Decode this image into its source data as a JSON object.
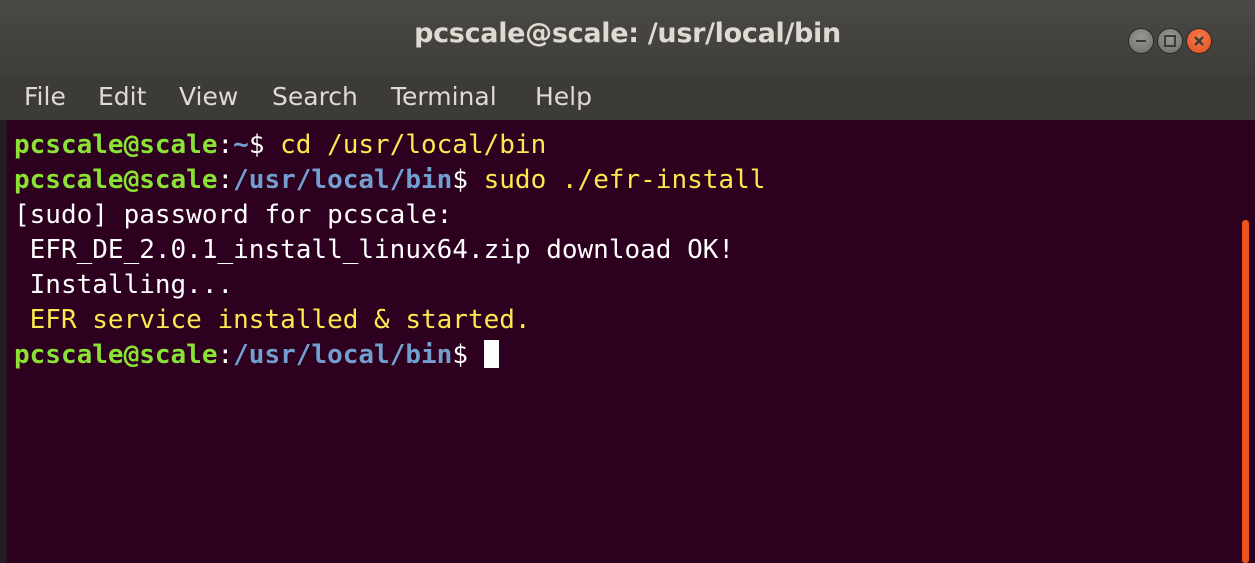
{
  "window": {
    "title": "pcscale@scale: /usr/local/bin",
    "controls": {
      "minimize_icon": "minimize-icon",
      "maximize_icon": "maximize-icon",
      "close_icon": "close-icon"
    }
  },
  "menu": {
    "items": [
      "File",
      "Edit",
      "View",
      "Search",
      "Terminal",
      "Help"
    ]
  },
  "terminal": {
    "lines": [
      {
        "prompt_user": "pcscale@scale",
        "prompt_sep": ":",
        "prompt_path": "~",
        "prompt_dollar": "$ ",
        "command": "cd /usr/local/bin"
      },
      {
        "prompt_user": "pcscale@scale",
        "prompt_sep": ":",
        "prompt_path": "/usr/local/bin",
        "prompt_dollar": "$ ",
        "command": "sudo ./efr-install"
      },
      {
        "output": "[sudo] password for pcscale:"
      },
      {
        "output": " EFR_DE_2.0.1_install_linux64.zip download OK!"
      },
      {
        "output": " Installing..."
      },
      {
        "output": " EFR service installed & started."
      },
      {
        "prompt_user": "pcscale@scale",
        "prompt_sep": ":",
        "prompt_path": "/usr/local/bin",
        "prompt_dollar": "$ "
      }
    ]
  },
  "colors": {
    "background": "#2c001e",
    "prompt_user": "#8ae234",
    "prompt_path": "#729fcf",
    "highlight": "#fce94f",
    "accent": "#e95420"
  }
}
